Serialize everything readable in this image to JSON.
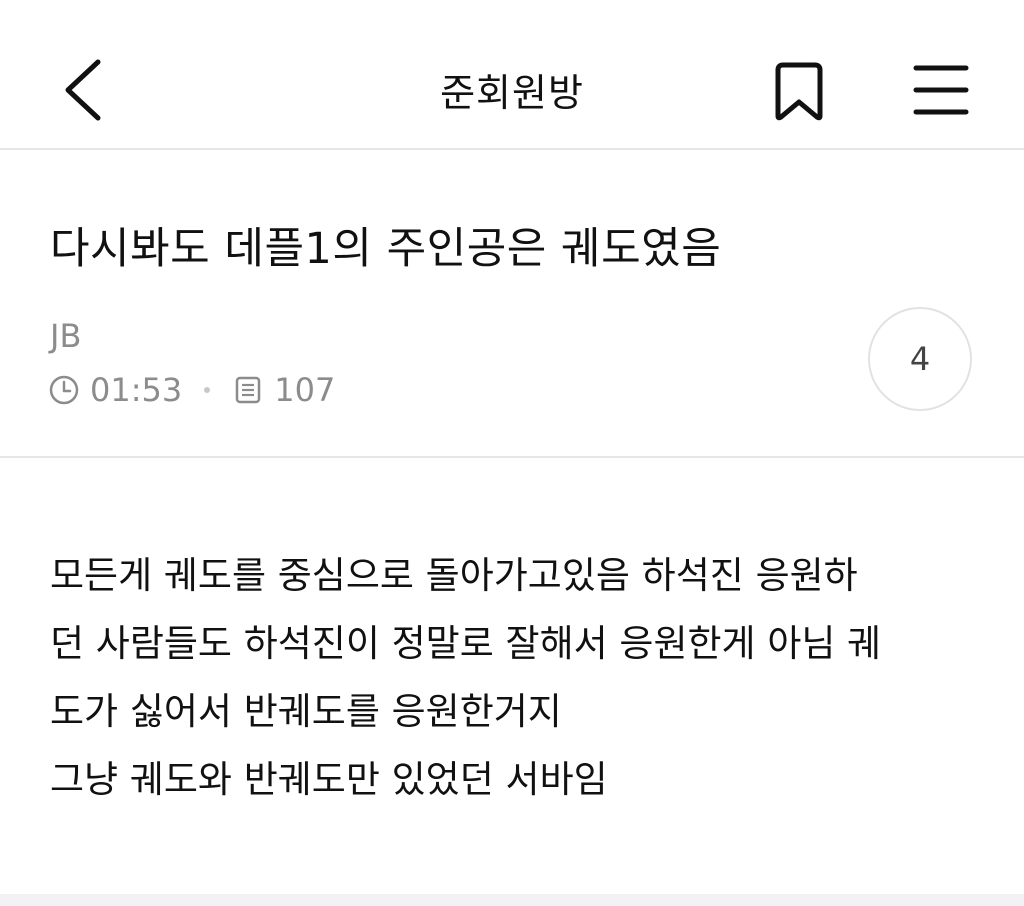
{
  "header": {
    "title": "준회원방",
    "back_icon": "chevron-left-icon",
    "bookmark_icon": "bookmark-icon",
    "menu_icon": "hamburger-menu-icon"
  },
  "post": {
    "title": "다시봐도 데플1의 주인공은 궤도였음",
    "author": "JB",
    "time": "01:53",
    "views": "107",
    "comment_count": "4",
    "content_lines": [
      "모든게 궤도를 중심으로 돌아가고있음 하석진 응원하",
      "던 사람들도 하석진이 정말로 잘해서 응원한게 아님 궤",
      "도가 싫어서 반궤도를 응원한거지",
      "그냥 궤도와 반궤도만 있었던 서바임"
    ]
  },
  "colors": {
    "text": "#111111",
    "meta": "#8c8c8c",
    "divider": "#e6e6e6"
  }
}
